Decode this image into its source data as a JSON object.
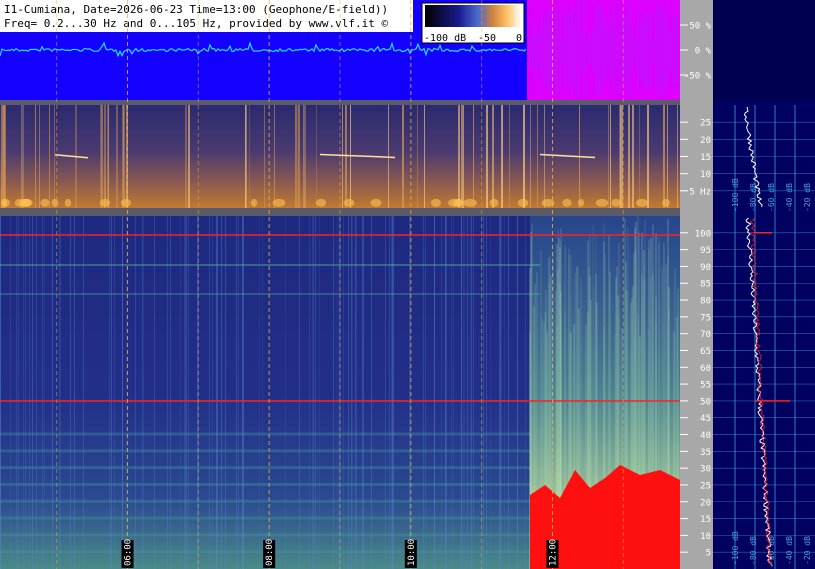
{
  "header": {
    "line1": "I1-Cumiana, Date=2026-06-23 Time=13:00 (Geophone/E-field))",
    "line2": "Freq= 0.2...30 Hz and 0...105 Hz, provided by www.vlf.it ©"
  },
  "colorbar": {
    "labels": [
      "-100 dB",
      "-50",
      "0"
    ]
  },
  "colors": {
    "background": "#000000",
    "waveform_bg": "#1400ff",
    "waveform_trace": "#22e0ff",
    "header_bg": "#ffffff",
    "panel_gray": "#a8a8a8",
    "spectrum_bg": "#000060",
    "grid": "#3a9be0",
    "red_line": "#ff2020",
    "magenta": "#ff00ff"
  },
  "chart_data": [
    {
      "type": "line",
      "name": "waveform",
      "ylim": [
        -100,
        100
      ],
      "yticks": [
        {
          "value": 50,
          "label": "50 %"
        },
        {
          "value": 0,
          "label": "0 %"
        },
        {
          "value": -50,
          "label": "-50 %"
        }
      ]
    },
    {
      "type": "heatmap",
      "name": "spectrogram-low",
      "ylim": [
        0,
        30
      ],
      "yticks": [
        {
          "value": 25,
          "label": "25"
        },
        {
          "value": 20,
          "label": "20"
        },
        {
          "value": 15,
          "label": "15"
        },
        {
          "value": 10,
          "label": "10"
        },
        {
          "value": 5,
          "label": "5 Hz"
        }
      ]
    },
    {
      "type": "heatmap",
      "name": "spectrogram-high",
      "ylim": [
        0,
        105
      ],
      "yticks": [
        {
          "value": 100,
          "label": "100"
        },
        {
          "value": 95,
          "label": "95"
        },
        {
          "value": 90,
          "label": "90"
        },
        {
          "value": 85,
          "label": "85"
        },
        {
          "value": 80,
          "label": "80"
        },
        {
          "value": 75,
          "label": "75"
        },
        {
          "value": 70,
          "label": "70"
        },
        {
          "value": 65,
          "label": "65"
        },
        {
          "value": 60,
          "label": "60"
        },
        {
          "value": 55,
          "label": "55"
        },
        {
          "value": 50,
          "label": "50"
        },
        {
          "value": 45,
          "label": "45"
        },
        {
          "value": 40,
          "label": "40"
        },
        {
          "value": 35,
          "label": "35"
        },
        {
          "value": 30,
          "label": "30"
        },
        {
          "value": 25,
          "label": "25"
        },
        {
          "value": 20,
          "label": "20"
        },
        {
          "value": 15,
          "label": "15"
        },
        {
          "value": 10,
          "label": "10"
        },
        {
          "value": 5,
          "label": "5"
        }
      ],
      "time_labels": [
        {
          "hours": 6,
          "label": "06:00"
        },
        {
          "hours": 8,
          "label": "08:00"
        },
        {
          "hours": 10,
          "label": "10:00"
        },
        {
          "hours": 12,
          "label": "12:00"
        }
      ]
    },
    {
      "type": "line",
      "name": "average-spectrum",
      "db_labels": [
        "-100 dB",
        "-80 dB",
        "-60 dB",
        "-40 dB",
        "-20 dB"
      ]
    }
  ]
}
